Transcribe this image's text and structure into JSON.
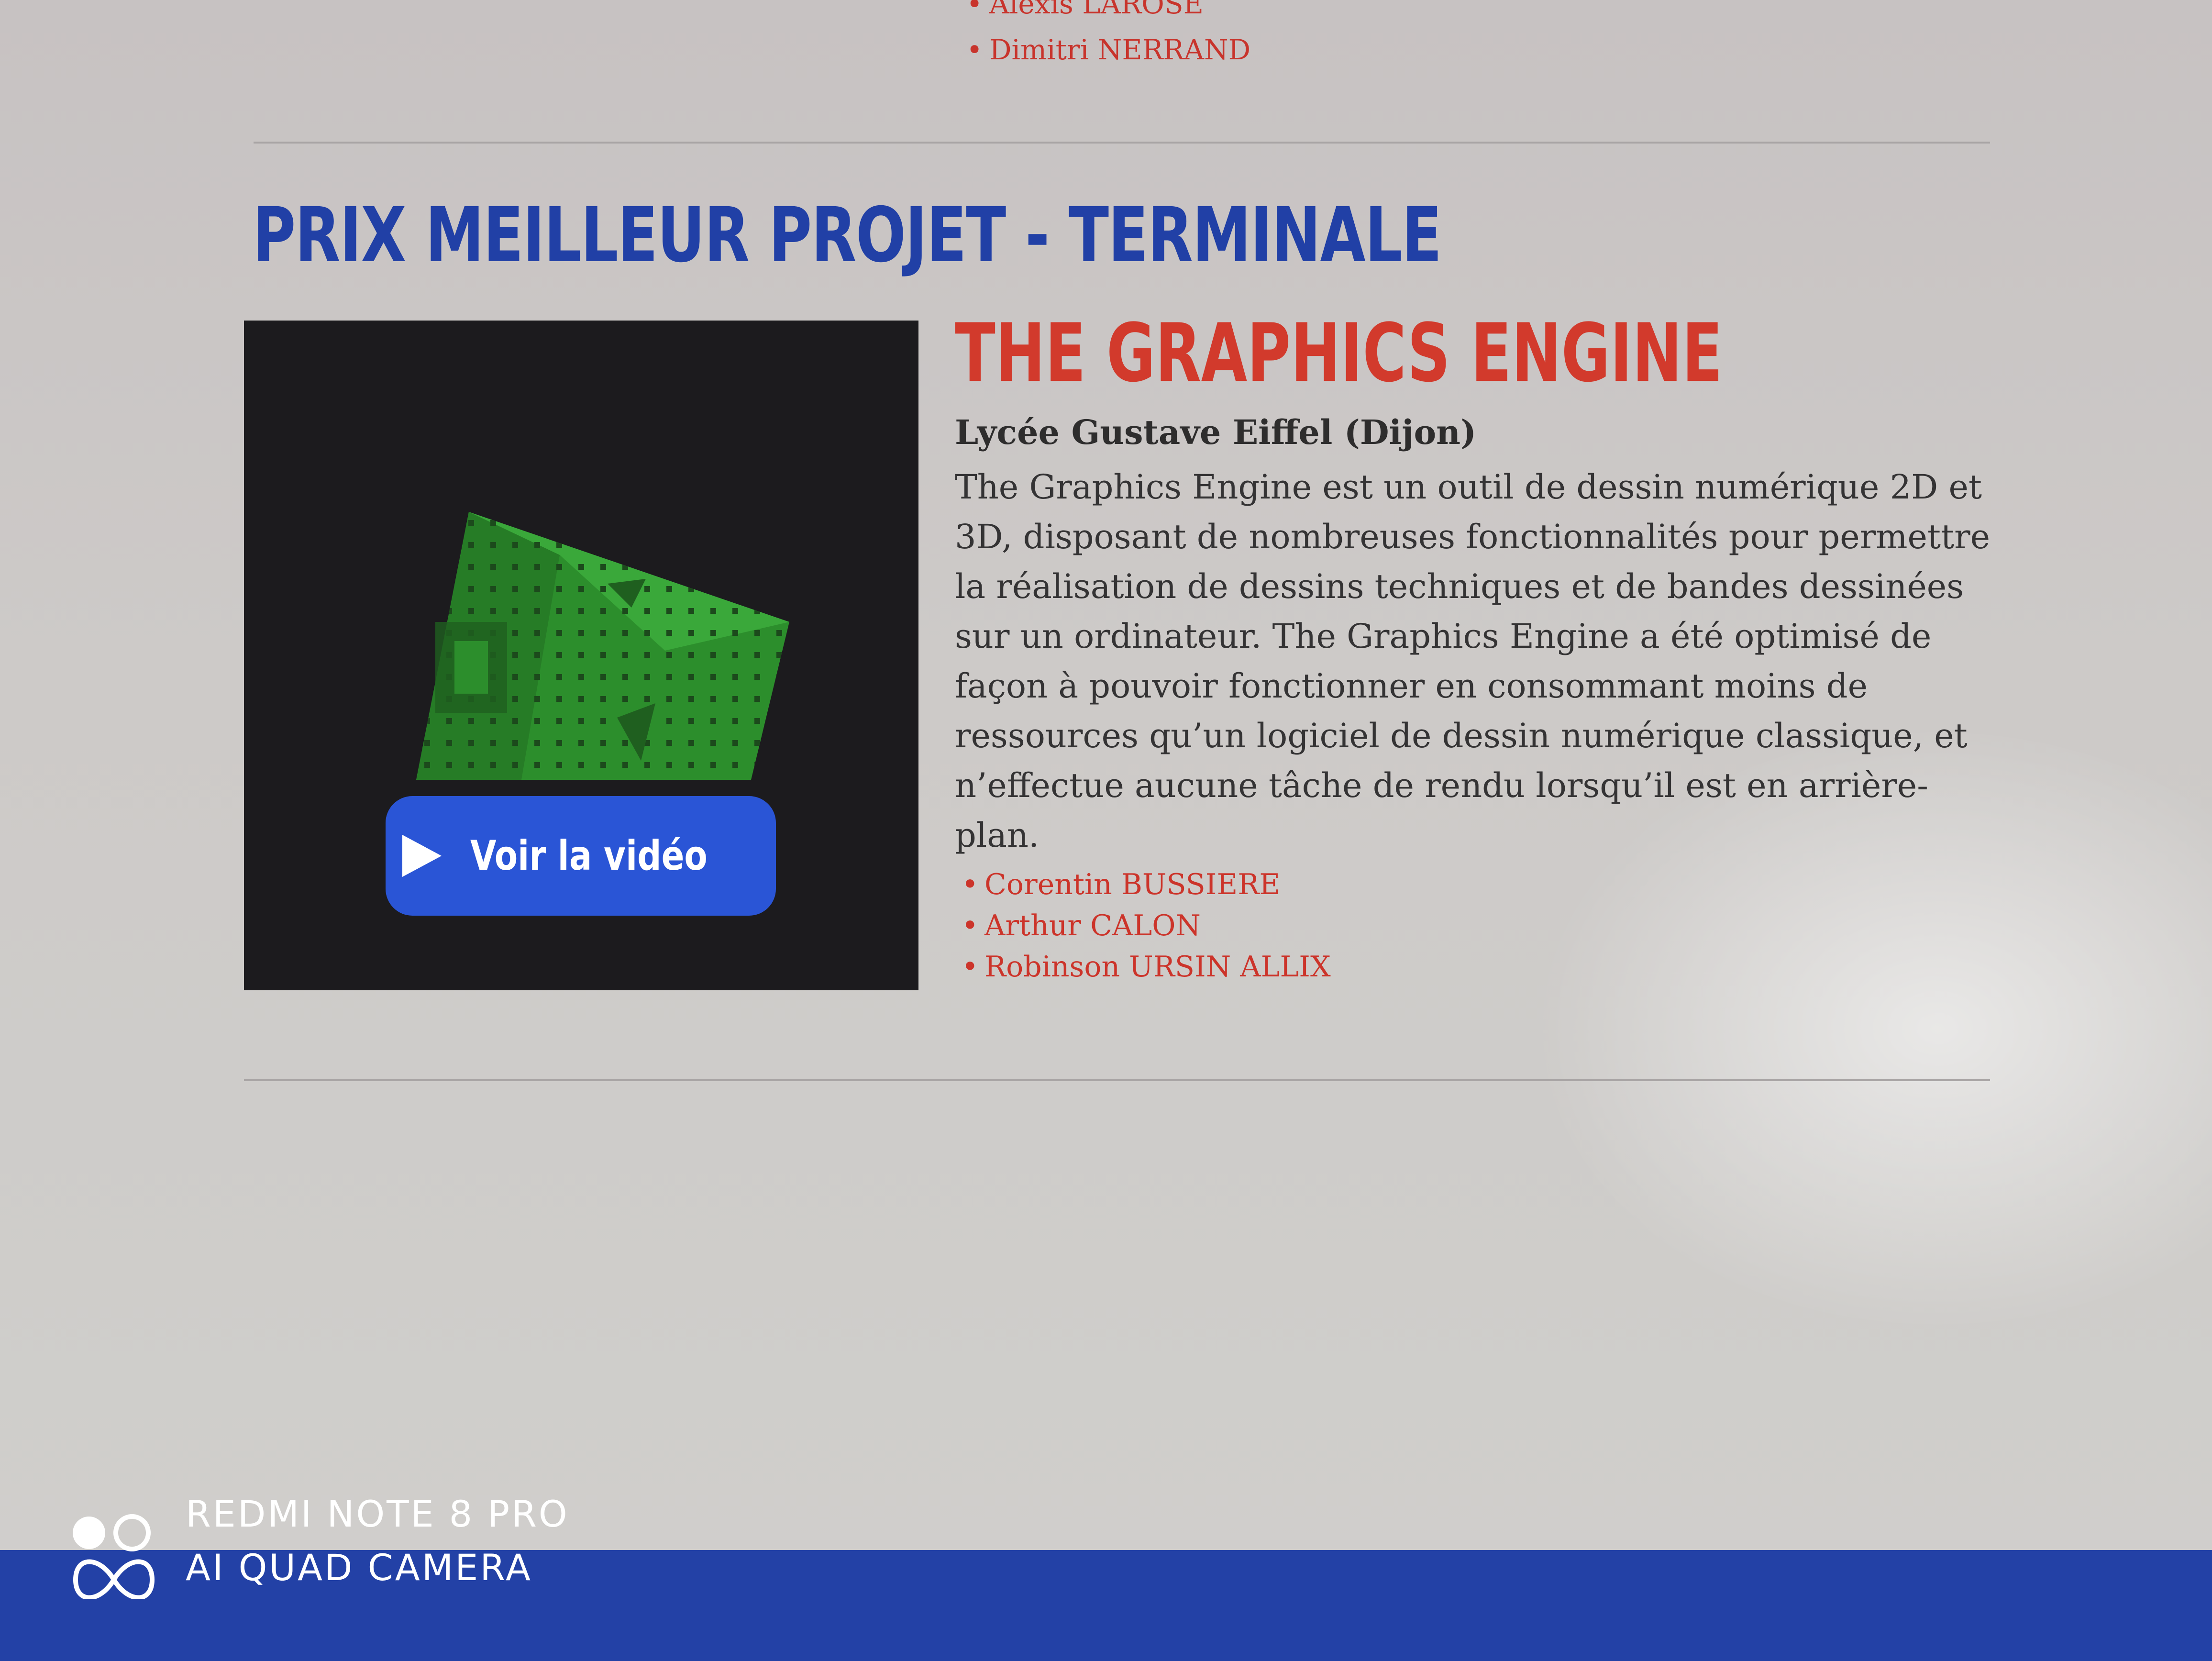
{
  "top_list": {
    "items": [
      "Alexis LAROSE",
      "Dimitri NERRAND"
    ]
  },
  "section": {
    "heading": "PRIX MEILLEUR PROJET - TERMINALE"
  },
  "video": {
    "button_label": "Voir la vidéo"
  },
  "project": {
    "title": "THE GRAPHICS ENGINE",
    "school": "Lycée Gustave Eiffel (Dijon)",
    "description": "The Graphics Engine est un outil de dessin numérique 2D et 3D, disposant de nombreuses fonctionnalités pour permettre la réalisation de dessins techniques et de bandes dessinées sur un ordinateur. The Graphics Engine a été optimisé de façon à pouvoir fonctionner en consommant moins de ressources qu’un logiciel de dessin numérique classique, et n’effectue aucune tâche de rendu lorsqu’il est en arrière-plan.",
    "authors": [
      "Corentin BUSSIERE",
      "Arthur CALON",
      "Robinson URSIN ALLIX"
    ]
  },
  "watermark": {
    "line1": "REDMI NOTE 8 PRO",
    "line2": "AI QUAD CAMERA"
  },
  "colors": {
    "heading_blue": "#2140a6",
    "title_red": "#d23a2c",
    "button_blue": "#2a55d6",
    "footer_blue": "#2341a6"
  }
}
